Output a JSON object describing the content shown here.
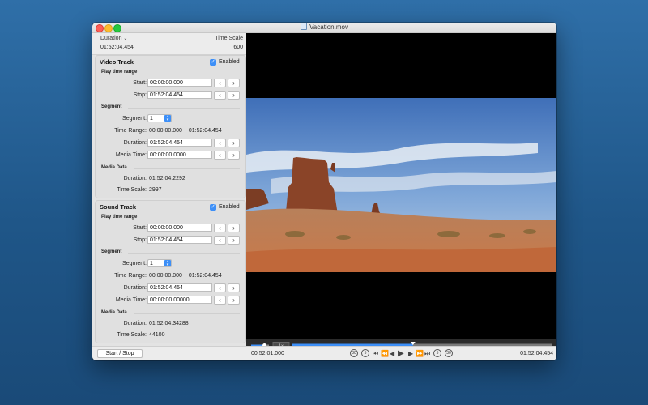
{
  "window": {
    "title": "Vacation.mov"
  },
  "header": {
    "duration_label": "Duration",
    "duration_value": "01:52:04.454",
    "timescale_label": "Time Scale",
    "timescale_value": "600"
  },
  "video_track": {
    "title": "Video Track",
    "enabled_label": "Enabled",
    "play_range_label": "Play time range",
    "start_label": "Start:",
    "start_value": "00:00:00.000",
    "stop_label": "Stop:",
    "stop_value": "01:52:04.454",
    "segment_heading": "Segment",
    "segment_label": "Segment:",
    "segment_value": "1",
    "time_range_label": "Time Range:",
    "time_range_value": "00:00:00.000 ~ 01:52:04.454",
    "duration_label": "Duration:",
    "duration_value": "01:52:04.454",
    "media_time_label": "Media Time:",
    "media_time_value": "00:00:00.0000",
    "media_data_heading": "Media Data",
    "md_duration_label": "Duration:",
    "md_duration_value": "01:52:04.2292",
    "md_timescale_label": "Time Scale:",
    "md_timescale_value": "2997"
  },
  "sound_track": {
    "title": "Sound Track",
    "enabled_label": "Enabled",
    "play_range_label": "Play time range",
    "start_label": "Start:",
    "start_value": "00:00:00.000",
    "stop_label": "Stop:",
    "stop_value": "01:52:04.454",
    "segment_heading": "Segment",
    "segment_label": "Segment:",
    "segment_value": "1",
    "time_range_label": "Time Range:",
    "time_range_value": "00:00:00.000 ~ 01:52:04.454",
    "duration_label": "Duration:",
    "duration_value": "01:52:04.454",
    "media_time_label": "Media Time:",
    "media_time_value": "00:00:00.00000",
    "media_data_heading": "Media Data",
    "md_duration_label": "Duration:",
    "md_duration_value": "01:52:04.34288",
    "md_timescale_label": "Time Scale:",
    "md_timescale_value": "44100"
  },
  "player": {
    "speed_label": "1x",
    "volume_level": 0.75,
    "playback_progress": 0.465,
    "start_stop_label": "Start / Stop",
    "current_time": "00:52:01.000",
    "end_time": "01:52:04.454",
    "skip_back_30": "30",
    "skip_back_5": "5",
    "skip_fwd_5": "5",
    "skip_fwd_30": "30"
  },
  "colors": {
    "accent": "#3d8ff7",
    "video_bg": "#000000"
  }
}
